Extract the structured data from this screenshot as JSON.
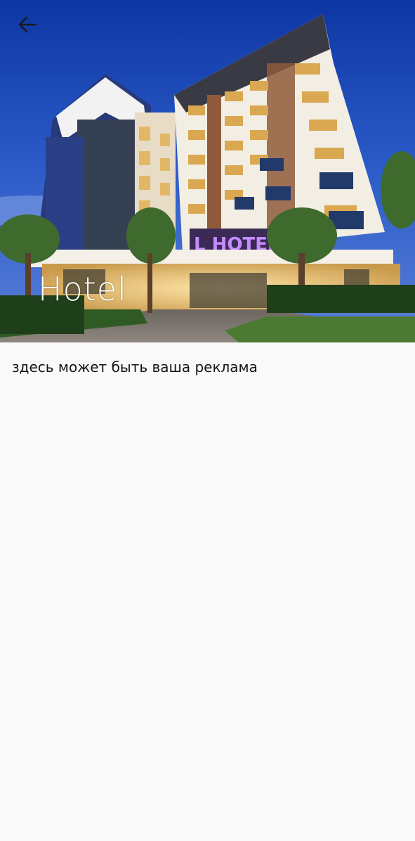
{
  "header": {
    "back_icon": "arrow-left-icon",
    "hotel_title": "Hotel",
    "sign_text": "L HOTEL"
  },
  "content": {
    "description": "здесь может быть ваша реклама"
  },
  "colors": {
    "sky_top": "#0f3aa6",
    "page_background": "#f9f9f9",
    "title_text": "#ffffff",
    "body_text": "#141414",
    "sign_glow": "#c58cff"
  }
}
